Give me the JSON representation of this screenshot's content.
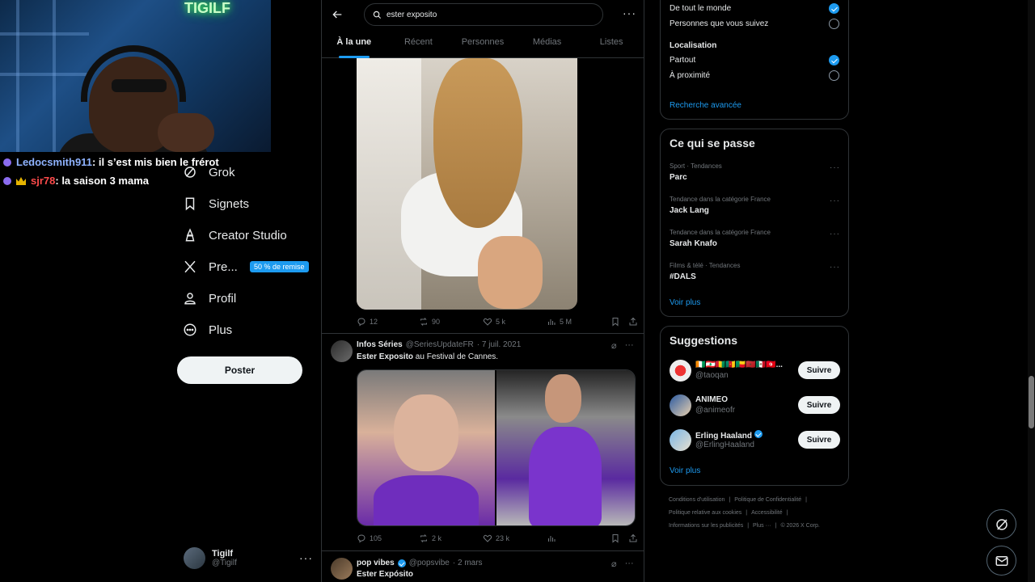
{
  "overlay": {
    "neon_sign": "TIGILF",
    "chat": [
      {
        "user": "Ledocsmith911",
        "message": ": il s’est mis bien le frérot"
      },
      {
        "user": "sjr78",
        "message": ": la saison 3 mama"
      }
    ]
  },
  "nav": {
    "items": [
      {
        "label": "Grok",
        "icon": "grok-icon"
      },
      {
        "label": "Signets",
        "icon": "bookmark-icon"
      },
      {
        "label": "Creator Studio",
        "icon": "creator-studio-icon"
      },
      {
        "label": "Pre...",
        "icon": "x-logo-icon"
      },
      {
        "label": "Profil",
        "icon": "profile-icon"
      },
      {
        "label": "Plus",
        "icon": "more-circle-icon"
      }
    ],
    "premium_badge": "50 % de remise",
    "post_button": "Poster",
    "account": {
      "name": "Tigilf",
      "handle": "@Tigilf"
    }
  },
  "search": {
    "query": "ester exposito",
    "tabs": [
      "À la une",
      "Récent",
      "Personnes",
      "Médias",
      "Listes"
    ],
    "active_tab": "À la une"
  },
  "tweets": [
    {
      "actions": {
        "replies": "12",
        "reposts": "90",
        "likes": "5 k",
        "views": "5 M"
      }
    },
    {
      "name": "Infos Séries",
      "handle": "@SeriesUpdateFR",
      "date": "· 7 juil. 2021",
      "text_bold": "Ester Exposito",
      "text_rest": " au Festival de Cannes.",
      "actions": {
        "replies": "105",
        "reposts": "2 k",
        "likes": "23 k",
        "views": ""
      }
    },
    {
      "name": "pop vibes",
      "handle": "@popsvibe",
      "date": "· 2 mars",
      "text_bold": "Ester Expósito",
      "verified": true
    }
  ],
  "filters": {
    "people": [
      {
        "label": "De tout le monde",
        "selected": true
      },
      {
        "label": "Personnes que vous suivez",
        "selected": false
      }
    ],
    "location_title": "Localisation",
    "location": [
      {
        "label": "Partout",
        "selected": true
      },
      {
        "label": "À proximité",
        "selected": false
      }
    ],
    "advanced_link": "Recherche avancée"
  },
  "trends": {
    "title": "Ce qui se passe",
    "items": [
      {
        "category": "Sport · Tendances",
        "name": "Parc"
      },
      {
        "category": "Tendance dans la catégorie France",
        "name": "Jack Lang"
      },
      {
        "category": "Tendance dans la catégorie France",
        "name": "Sarah Knafo"
      },
      {
        "category": "Films & télé · Tendances",
        "name": "#DALS"
      }
    ],
    "more_link": "Voir plus"
  },
  "suggestions": {
    "title": "Suggestions",
    "items": [
      {
        "name": "🇨🇮🇱🇧🇬🇳🇨🇲🇧🇯🇲🇦🇲🇽🇹🇳...",
        "handle": "@taoqan",
        "button": "Suivre"
      },
      {
        "name": "ANIMEO",
        "handle": "@animeofr",
        "button": "Suivre"
      },
      {
        "name": "Erling Haaland",
        "handle": "@ErlingHaaland",
        "button": "Suivre",
        "verified": true
      }
    ],
    "more_link": "Voir plus"
  },
  "footer": {
    "line1": [
      "Conditions d'utilisation",
      "|",
      "Politique de Confidentialité",
      "|"
    ],
    "line2": [
      "Politique relative aux cookies",
      "|",
      "Accessibilité",
      "|"
    ],
    "line3": [
      "Informations sur les publicités",
      "|",
      "Plus ···",
      "|",
      "© 2026 X Corp."
    ]
  },
  "colors": {
    "accent": "#1d9bf0",
    "background": "#000000",
    "text": "#e7e9ea",
    "muted": "#71767b",
    "border": "#2f3336"
  }
}
